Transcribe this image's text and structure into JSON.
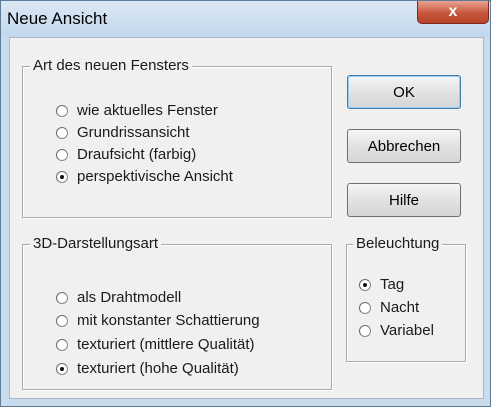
{
  "window": {
    "title": "Neue Ansicht",
    "close_glyph": "x"
  },
  "group_window_type": {
    "legend": "Art des neuen Fensters",
    "options": [
      {
        "label": "wie aktuelles Fenster",
        "checked": false
      },
      {
        "label": "Grundrissansicht",
        "checked": false
      },
      {
        "label": "Draufsicht (farbig)",
        "checked": false
      },
      {
        "label": "perspektivische Ansicht",
        "checked": true
      }
    ]
  },
  "group_render_mode": {
    "legend": "3D-Darstellungsart",
    "options": [
      {
        "label": "als Drahtmodell",
        "checked": false
      },
      {
        "label": "mit konstanter Schattierung",
        "checked": false
      },
      {
        "label": "texturiert (mittlere Qualität)",
        "checked": false
      },
      {
        "label": "texturiert (hohe Qualität)",
        "checked": true
      }
    ]
  },
  "group_lighting": {
    "legend": "Beleuchtung",
    "options": [
      {
        "label": "Tag",
        "checked": true
      },
      {
        "label": "Nacht",
        "checked": false
      },
      {
        "label": "Variabel",
        "checked": false
      }
    ]
  },
  "buttons": {
    "ok": "OK",
    "cancel": "Abbrechen",
    "help": "Hilfe"
  },
  "icons": {
    "close": "close-icon",
    "radio": "radio-button-icon"
  },
  "colors": {
    "title_bar": "#c9dcee",
    "close_button": "#c8563c",
    "dialog_bg": "#f0f0f0"
  }
}
